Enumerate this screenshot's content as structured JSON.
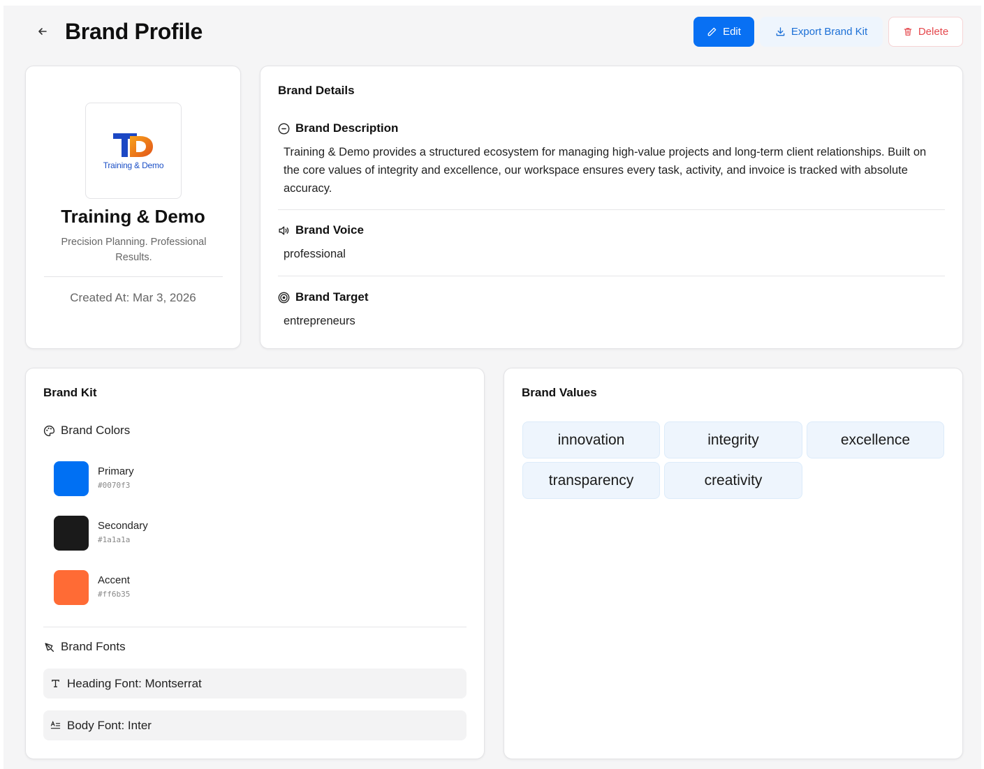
{
  "header": {
    "title": "Brand Profile",
    "edit_label": "Edit",
    "export_label": "Export Brand Kit",
    "delete_label": "Delete"
  },
  "profile": {
    "logo_text": "Training & Demo",
    "name": "Training & Demo",
    "tagline": "Precision Planning. Professional Results.",
    "created_at": "Created At: Mar 3, 2026"
  },
  "details": {
    "heading": "Brand Details",
    "description_title": "Brand Description",
    "description": "Training & Demo provides a structured ecosystem for managing high-value projects and long-term client relationships. Built on the core values of integrity and excellence, our workspace ensures every task, activity, and invoice is tracked with absolute accuracy.",
    "voice_title": "Brand Voice",
    "voice": "professional",
    "target_title": "Brand Target",
    "target": "entrepreneurs"
  },
  "kit": {
    "heading": "Brand Kit",
    "colors_title": "Brand Colors",
    "colors": [
      {
        "name": "Primary",
        "hex": "#0070f3"
      },
      {
        "name": "Secondary",
        "hex": "#1a1a1a"
      },
      {
        "name": "Accent",
        "hex": "#ff6b35"
      }
    ],
    "fonts_title": "Brand Fonts",
    "heading_font": "Heading Font: Montserrat",
    "body_font": "Body Font: Inter"
  },
  "values": {
    "heading": "Brand Values",
    "items": [
      "innovation",
      "integrity",
      "excellence",
      "transparency",
      "creativity"
    ]
  },
  "colors": {
    "accent": "#0870f3",
    "danger": "#e5484d"
  }
}
